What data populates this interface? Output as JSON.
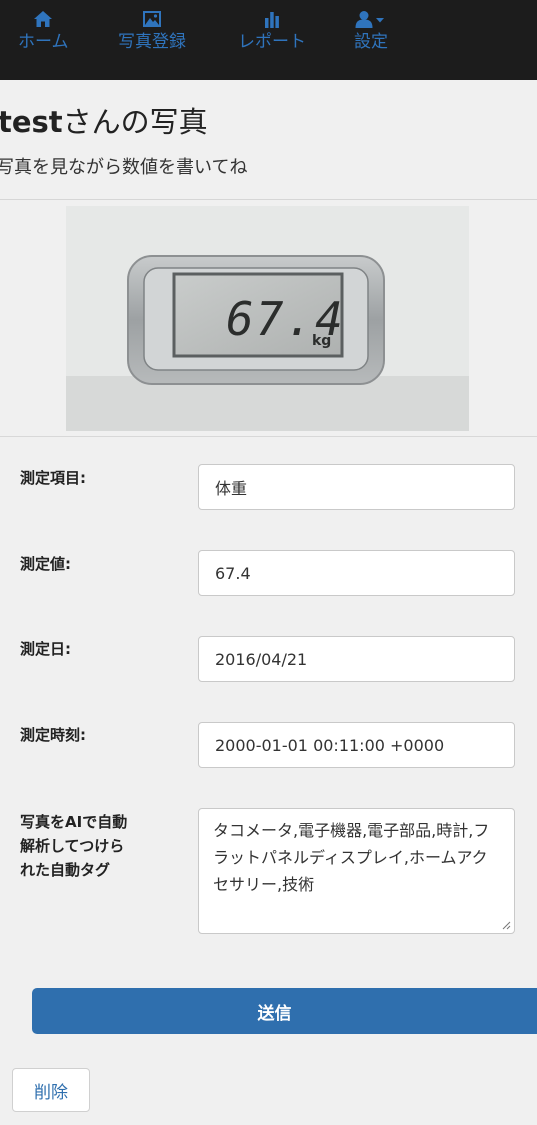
{
  "nav": {
    "items": [
      {
        "label": "ホーム",
        "icon": "home-icon"
      },
      {
        "label": "写真登録",
        "icon": "picture-icon"
      },
      {
        "label": "レポート",
        "icon": "bar-chart-icon"
      },
      {
        "label": "設定",
        "icon": "user-dropdown-icon"
      }
    ]
  },
  "header": {
    "title_bold": "test",
    "title_rest": "さんの写真",
    "subtitle": "写真を見ながら数値を書いてね"
  },
  "photo": {
    "display_reading": "67.4",
    "unit": "kg"
  },
  "form": {
    "item_label": "測定項目:",
    "item_value": "体重",
    "value_label": "測定値:",
    "value_value": "67.4",
    "date_label": "測定日:",
    "date_value": "2016/04/21",
    "time_label": "測定時刻:",
    "time_value": "2000-01-01 00:11:00 +0000",
    "tags_label_line1": "写真をAIで自動",
    "tags_label_line2": "解析してつけら",
    "tags_label_line3": "れた自動タグ",
    "tags_value": "タコメータ,電子機器,電子部品,時計,フラットパネルディスプレイ,ホームアクセサリー,技術"
  },
  "buttons": {
    "submit": "送信",
    "delete": "削除"
  },
  "colors": {
    "navbar_bg": "#1c1c1c",
    "link_blue": "#2f74bd",
    "primary": "#2f6fae",
    "page_bg": "#f0f0f0"
  }
}
